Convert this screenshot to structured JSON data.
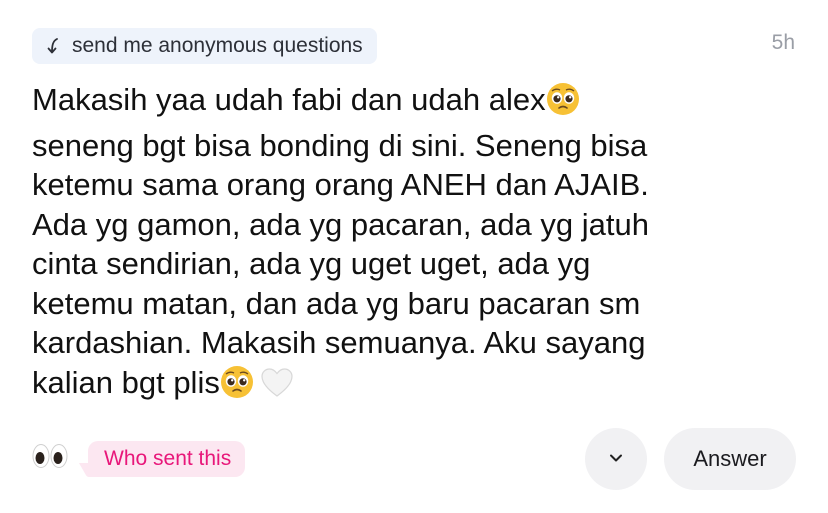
{
  "prompt": {
    "label": "send me anonymous questions",
    "icon": "curved-arrow-icon"
  },
  "time": "5h",
  "message": {
    "lines": [
      "Makasih yaa udah fabi dan udah alex",
      "seneng bgt bisa bonding di sini. Seneng bisa",
      "ketemu sama orang orang ANEH dan AJAIB.",
      "Ada yg gamon, ada yg pacaran, ada yg jatuh",
      "cinta sendirian, ada yg uget uget, ada yg",
      "ketemu matan, dan ada yg baru pacaran sm",
      "kardashian. Makasih semuanya. Aku sayang",
      "kalian bgt plis"
    ],
    "emojis": [
      "pleading-face-emoji",
      "pleading-face-emoji",
      "white-heart-emoji"
    ]
  },
  "footer": {
    "eyes_icon": "eyes-emoji",
    "who_sent_label": "Who sent this",
    "expand_icon": "chevron-down-icon",
    "answer_label": "Answer"
  },
  "colors": {
    "pill_bg": "#eef3fb",
    "who_bg": "#fce7f1",
    "who_text": "#e8177a",
    "button_bg": "#f1f1f3",
    "timestamp": "#9a9ea6"
  }
}
